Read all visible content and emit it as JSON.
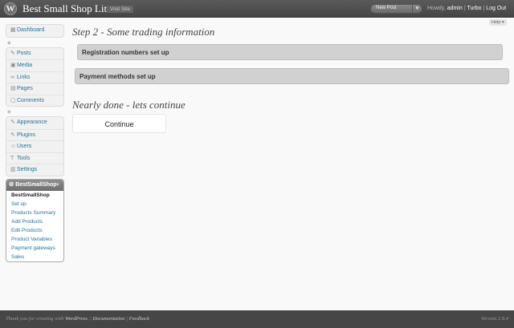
{
  "header": {
    "site_title": "Best Small Shop Lite",
    "visit_site": "Visit Site",
    "favorite_action": "New Post",
    "howdy": "Howdy,",
    "username": "admin",
    "turbo": "Turbo",
    "logout": "Log Out",
    "separator": "|"
  },
  "help": "Help ▾",
  "menu": {
    "dashboard": "Dashboard",
    "content_items": [
      {
        "label": "Posts",
        "icon": "pin-icon",
        "glyph": "✎"
      },
      {
        "label": "Media",
        "icon": "media-icon",
        "glyph": "▣"
      },
      {
        "label": "Links",
        "icon": "links-icon",
        "glyph": "∞"
      },
      {
        "label": "Pages",
        "icon": "pages-icon",
        "glyph": "▤"
      },
      {
        "label": "Comments",
        "icon": "comments-icon",
        "glyph": "▢"
      }
    ],
    "settings_items": [
      {
        "label": "Appearance",
        "icon": "appearance-icon",
        "glyph": "✎"
      },
      {
        "label": "Plugins",
        "icon": "plugins-icon",
        "glyph": "✎"
      },
      {
        "label": "Users",
        "icon": "users-icon",
        "glyph": "☺"
      },
      {
        "label": "Tools",
        "icon": "tools-icon",
        "glyph": "T"
      },
      {
        "label": "Settings",
        "icon": "settings-icon",
        "glyph": "▥"
      }
    ],
    "shop": {
      "title": "BestSmallShop",
      "items": [
        "BestSmallShop",
        "Set up",
        "Products Summary",
        "Add Products",
        "Edit Products",
        "Product Variables",
        "Payment gateways",
        "Sales"
      ]
    }
  },
  "main": {
    "step_heading": "Step 2 - Some trading information",
    "registration_bar": "Registration numbers set up",
    "payment_bar": "Payment methods set up",
    "nearly_heading": "Nearly done - lets continue",
    "continue_button": "Continue"
  },
  "footer": {
    "thanks": "Thank you for creating with",
    "wordpress": "WordPress",
    "period": ".",
    "documentation": "Documentation",
    "feedback": "Feedback",
    "separator": "|",
    "version": "Version 2.8.4"
  },
  "colors": {
    "header_bg": "#464646",
    "link": "#21759b",
    "bar_bg": "#d1d1d1",
    "page_bg": "#f9f9f9"
  }
}
